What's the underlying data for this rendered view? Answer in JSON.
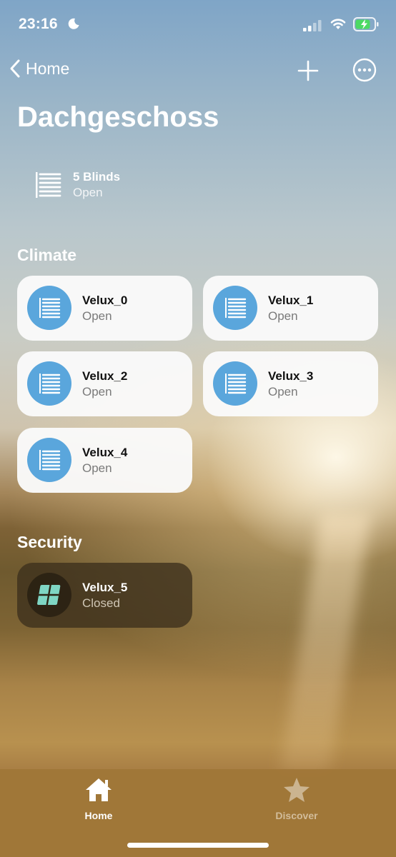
{
  "status": {
    "time": "23:16"
  },
  "nav": {
    "back_label": "Home"
  },
  "page": {
    "title": "Dachgeschoss"
  },
  "summary": {
    "name": "5 Blinds",
    "state": "Open",
    "icon": "blinds-icon"
  },
  "sections": {
    "climate": "Climate",
    "security": "Security"
  },
  "climate_tiles": [
    {
      "name": "Velux_0",
      "state": "Open"
    },
    {
      "name": "Velux_1",
      "state": "Open"
    },
    {
      "name": "Velux_2",
      "state": "Open"
    },
    {
      "name": "Velux_3",
      "state": "Open"
    },
    {
      "name": "Velux_4",
      "state": "Open"
    }
  ],
  "security_tiles": [
    {
      "name": "Velux_5",
      "state": "Closed",
      "icon": "window-icon"
    }
  ],
  "tabs": [
    {
      "label": "Home",
      "icon": "house-icon",
      "active": true
    },
    {
      "label": "Discover",
      "icon": "star-icon",
      "active": false
    }
  ],
  "colors": {
    "accent_blue": "#5aa6dc",
    "battery_green": "#4cd964",
    "window_teal": "#7fd6c4"
  }
}
